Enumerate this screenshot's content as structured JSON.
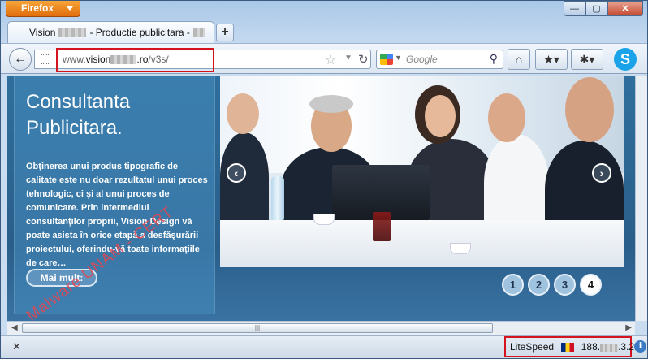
{
  "browser": {
    "app_button": "Firefox",
    "tab_title_prefix": "Vision",
    "tab_title_suffix": "- Productie publicitara -",
    "new_tab": "+",
    "url_prefix": "www.",
    "url_host_start": "vision",
    "url_host_end": ".ro",
    "url_path": "/v3s/",
    "search_placeholder": "Google",
    "window_controls": [
      "—",
      "▢",
      "✕"
    ]
  },
  "page": {
    "title": "Consultanta Publicitara.",
    "body": "Obţinerea unui produs tipografic de calitate este nu doar rezultatul unui proces tehnologic, ci şi al unui proces de comunicare. Prin intermediul consultanţilor proprii, Vision Design vă poate asista în orice etapă a desfăşurării proiectului, oferindu-vă toate informaţiile de care…",
    "more_button": "Mai mult:",
    "watermark": "Malware UNAM - CERT",
    "slider_pages": [
      "1",
      "2",
      "3",
      "4"
    ],
    "active_page": "4"
  },
  "statusbar": {
    "server": "LiteSpeed",
    "ip_start": "188.",
    "ip_end": ".3.21",
    "close": "✕"
  },
  "icons": [
    "firefox-icon",
    "back-icon",
    "star-icon",
    "reload-icon",
    "google-icon",
    "search-icon",
    "home-icon",
    "bookmarks-icon",
    "addon-icon",
    "skype-icon",
    "prev-arrow-icon",
    "next-arrow-icon",
    "flag-icon",
    "info-icon"
  ]
}
